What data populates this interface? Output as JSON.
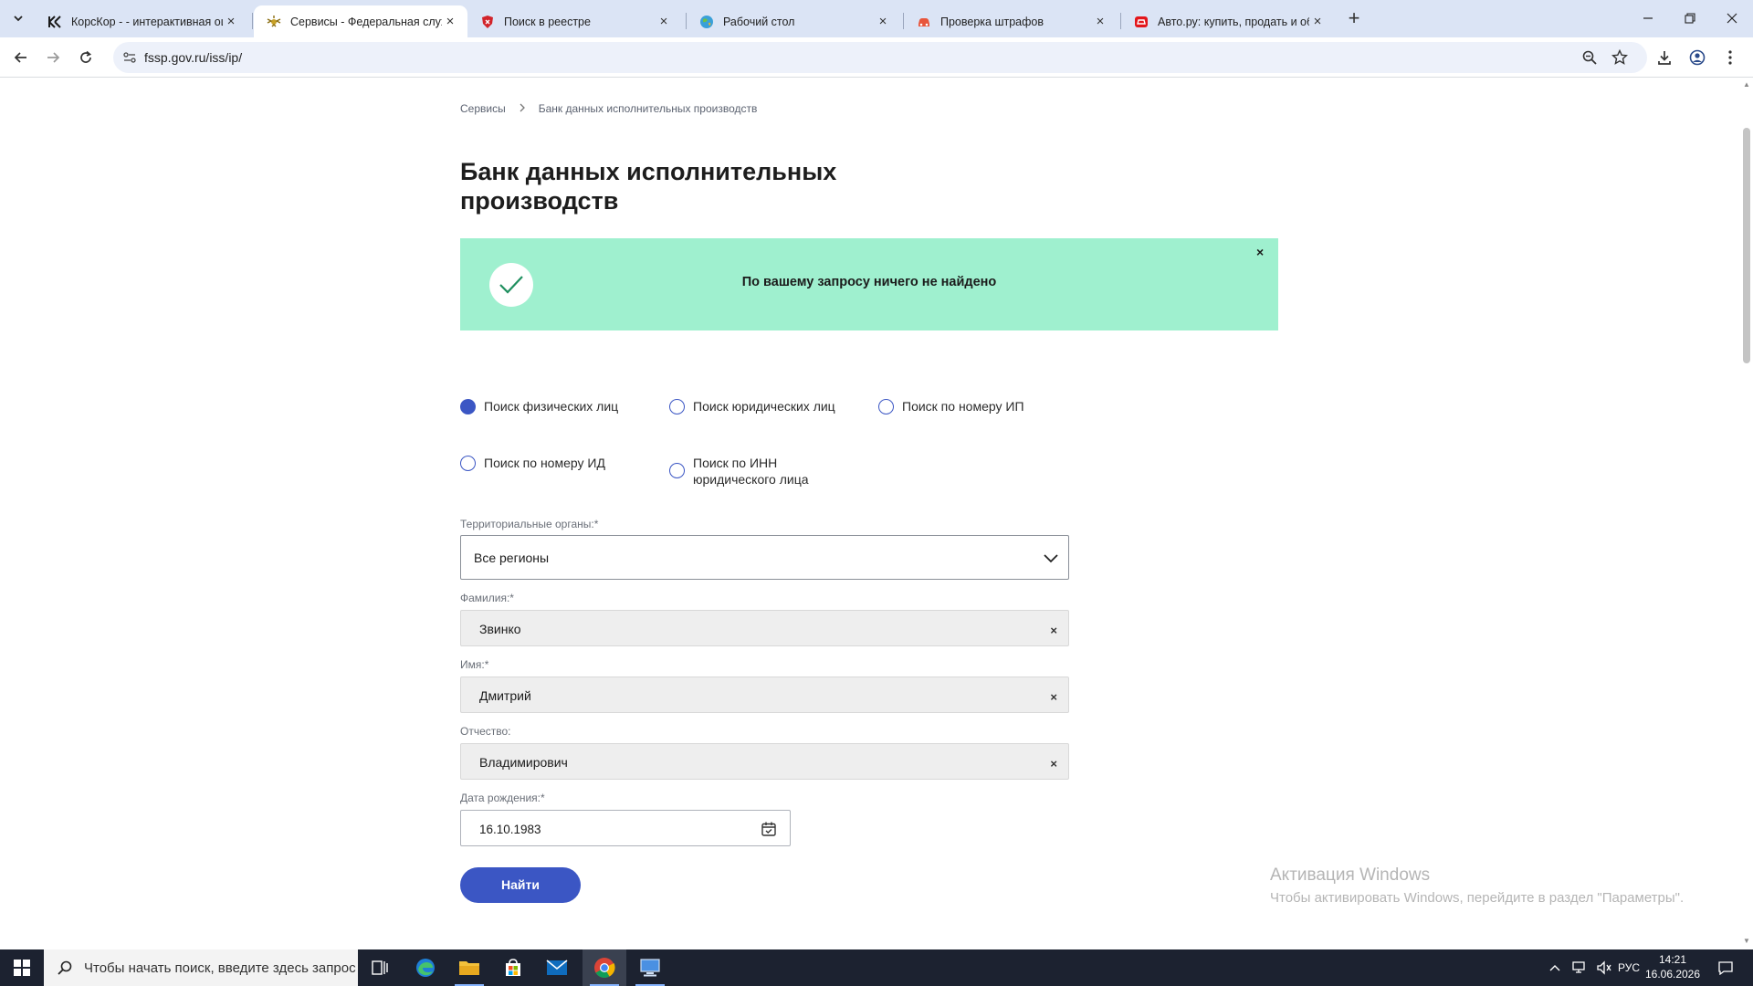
{
  "browser": {
    "tabs": [
      {
        "title": "КорсКор - - интерактивная оце",
        "active": false,
        "favicon": "korskor-icon"
      },
      {
        "title": "Сервисы - Федеральная служб",
        "active": true,
        "favicon": "fssp-emblem-icon"
      },
      {
        "title": "Поиск в реестре",
        "active": false,
        "favicon": "shield-icon"
      },
      {
        "title": "Рабочий стол",
        "active": false,
        "favicon": "globe-icon"
      },
      {
        "title": "Проверка штрафов",
        "active": false,
        "favicon": "car-icon"
      },
      {
        "title": "Авто.ру: купить, продать и обм",
        "active": false,
        "favicon": "autoru-icon"
      }
    ],
    "url": "fssp.gov.ru/iss/ip/"
  },
  "page": {
    "breadcrumbs": [
      "Сервисы",
      "Банк данных исполнительных производств"
    ],
    "title": "Банк данных исполнительных производств",
    "banner": {
      "message": "По вашему запросу ничего не найдено",
      "close": "×"
    },
    "search_types": [
      {
        "label": "Поиск физических лиц",
        "selected": true
      },
      {
        "label": "Поиск юридических лиц",
        "selected": false
      },
      {
        "label": "Поиск по номеру ИП",
        "selected": false
      },
      {
        "label": "Поиск по номеру ИД",
        "selected": false
      },
      {
        "label": "Поиск по ИНН юридического лица",
        "selected": false
      }
    ],
    "form": {
      "region_label": "Территориальные органы:*",
      "region_value": "Все регионы",
      "lastname_label": "Фамилия:*",
      "lastname_value": "Звинко",
      "firstname_label": "Имя:*",
      "firstname_value": "Дмитрий",
      "patronymic_label": "Отчество:",
      "patronymic_value": "Владимирович",
      "birthdate_label": "Дата рождения:*",
      "birthdate_value": "16.10.1983",
      "clear_symbol": "×",
      "submit_label": "Найти"
    },
    "watermark": {
      "title": "Активация Windows",
      "subtitle": "Чтобы активировать Windows, перейдите в раздел \"Параметры\"."
    }
  },
  "taskbar": {
    "search_placeholder": "Чтобы начать поиск, введите здесь запрос",
    "language": "РУС",
    "time": "14:21",
    "date": "16.06.2026"
  },
  "colors": {
    "accent": "#3b56c4",
    "banner_bg": "#9ff0cf",
    "tabstrip_bg": "#dbe4f5",
    "taskbar_bg": "#1c2230"
  }
}
